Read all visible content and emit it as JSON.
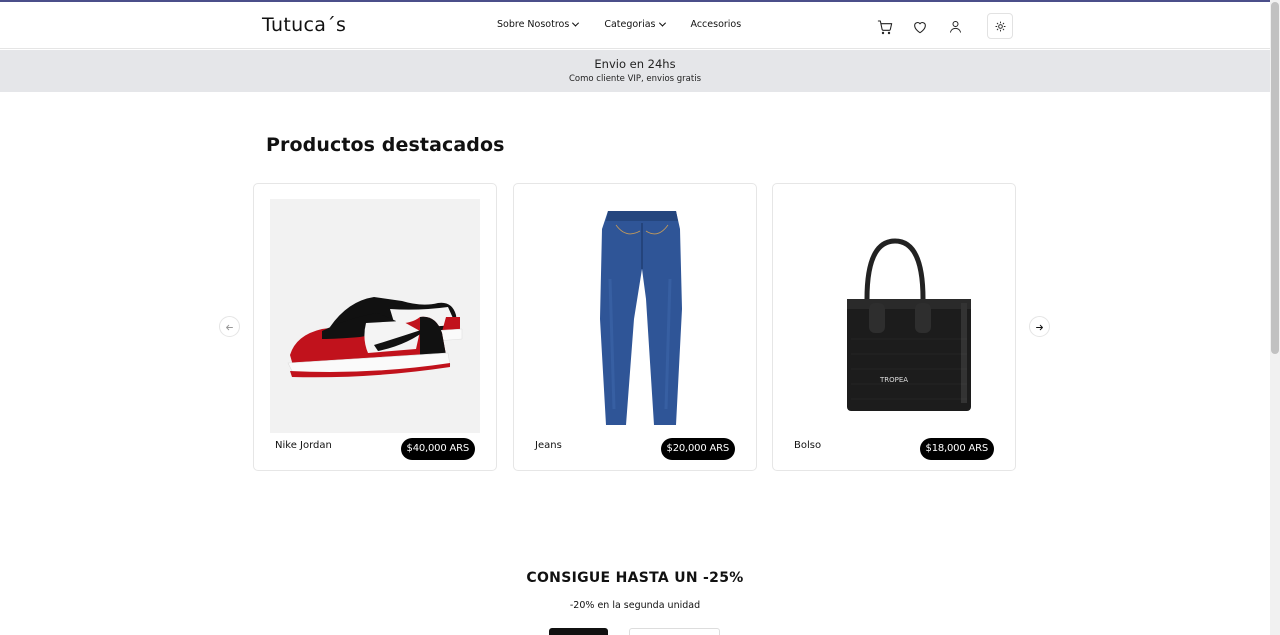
{
  "header": {
    "logo": "Tutuca´s",
    "nav": [
      {
        "label": "Sobre Nosotros",
        "dropdown": true
      },
      {
        "label": "Categorias",
        "dropdown": true
      },
      {
        "label": "Accesorios",
        "dropdown": false
      }
    ],
    "icons": [
      "cart-icon",
      "heart-icon",
      "user-icon",
      "sun-icon"
    ]
  },
  "banner": {
    "line1": "Envio en 24hs",
    "line2": "Como cliente VIP, envios gratis"
  },
  "featured": {
    "title": "Productos destacados",
    "products": [
      {
        "name": "Nike Jordan",
        "price": "$40,000 ARS"
      },
      {
        "name": "Jeans",
        "price": "$20,000 ARS"
      },
      {
        "name": "Bolso",
        "price": "$18,000 ARS",
        "bag_text": "TROPEA"
      }
    ]
  },
  "promo": {
    "title": "CONSIGUE HASTA UN -25%",
    "subtitle": "-20% en la segunda unidad"
  },
  "colors": {
    "accent_line": "#4b4f8a",
    "banner_bg": "#e5e6e9",
    "price_badge": "#000000"
  }
}
